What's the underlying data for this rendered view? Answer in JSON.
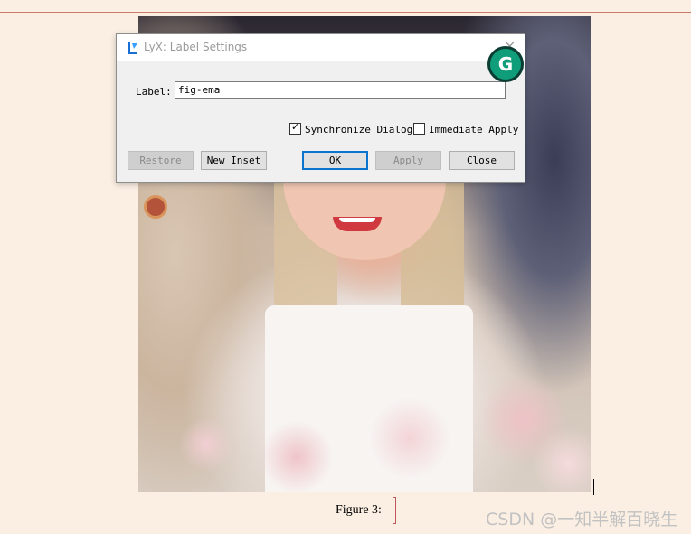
{
  "dialog": {
    "title": "LyX: Label Settings",
    "close_glyph": "×",
    "label_caption": "Label:",
    "label_value": "fig-ema",
    "sync_label": "Synchronize Dialog",
    "sync_checked": true,
    "immediate_label": "Immediate Apply",
    "immediate_checked": false,
    "buttons": {
      "restore": "Restore",
      "new_inset": "New Inset",
      "ok": "OK",
      "apply": "Apply",
      "close": "Close"
    }
  },
  "document": {
    "caption": "Figure 3:"
  },
  "grammarly_letter": "G",
  "watermark": "CSDN @一知半解百晓生",
  "colors": {
    "background": "#fbefe3",
    "default_button_border": "#0a74d0",
    "grammarly": "#0f9d7a"
  }
}
